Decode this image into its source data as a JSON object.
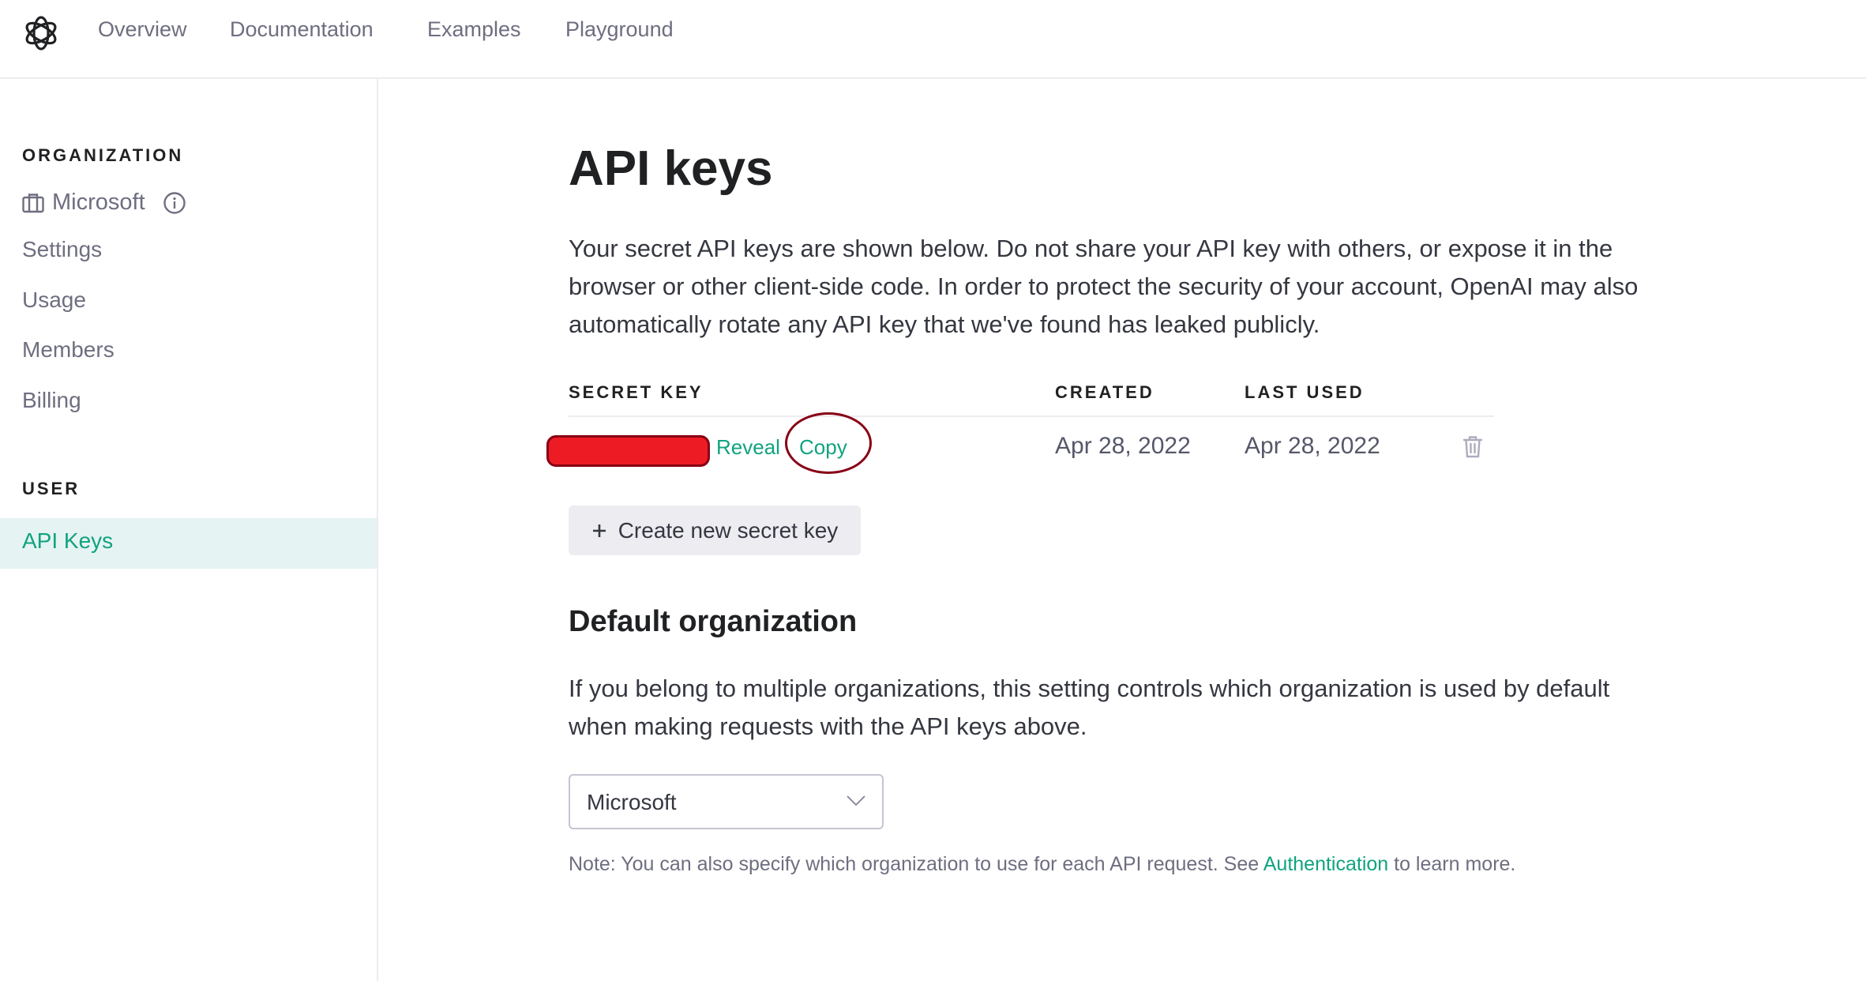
{
  "header": {
    "logo": "openai-logo",
    "nav": [
      "Overview",
      "Documentation",
      "Examples",
      "Playground"
    ]
  },
  "sidebar": {
    "organization_heading": "ORGANIZATION",
    "org_name": "Microsoft",
    "org_items": [
      "Settings",
      "Usage",
      "Members",
      "Billing"
    ],
    "user_heading": "USER",
    "user_items": [
      {
        "label": "API Keys",
        "active": true
      }
    ]
  },
  "main": {
    "title": "API keys",
    "description_lines": [
      "Your secret API keys are shown below. Do not share your API key with others, or expose it in the",
      "browser or other client-side code. In order to protect the security of your account, OpenAI may also",
      "automatically rotate any API key that we've found has leaked publicly."
    ],
    "table": {
      "columns": [
        "SECRET KEY",
        "CREATED",
        "LAST USED"
      ],
      "rows": [
        {
          "secret_key": "[redacted]",
          "reveal_label": "Reveal",
          "copy_label": "Copy",
          "created": "Apr 28, 2022",
          "last_used": "Apr 28, 2022"
        }
      ]
    },
    "create_button_label": "Create new secret key",
    "default_org": {
      "heading": "Default organization",
      "description_lines": [
        "If you belong to multiple organizations, this setting controls which organization is used by default",
        "when making requests with the API keys above."
      ],
      "selected": "Microsoft",
      "note_prefix": "Note: You can also specify which organization to use for each API request. See ",
      "note_link": "Authentication",
      "note_suffix": " to learn more."
    }
  },
  "annotations": {
    "redaction_color": "#ed1c24",
    "highlight_circle_color": "#880015"
  },
  "colors": {
    "accent": "#10a37f",
    "active_bg": "#e6f3f3",
    "text": "#202123",
    "muted": "#6e6e80",
    "border": "#ececf1"
  }
}
